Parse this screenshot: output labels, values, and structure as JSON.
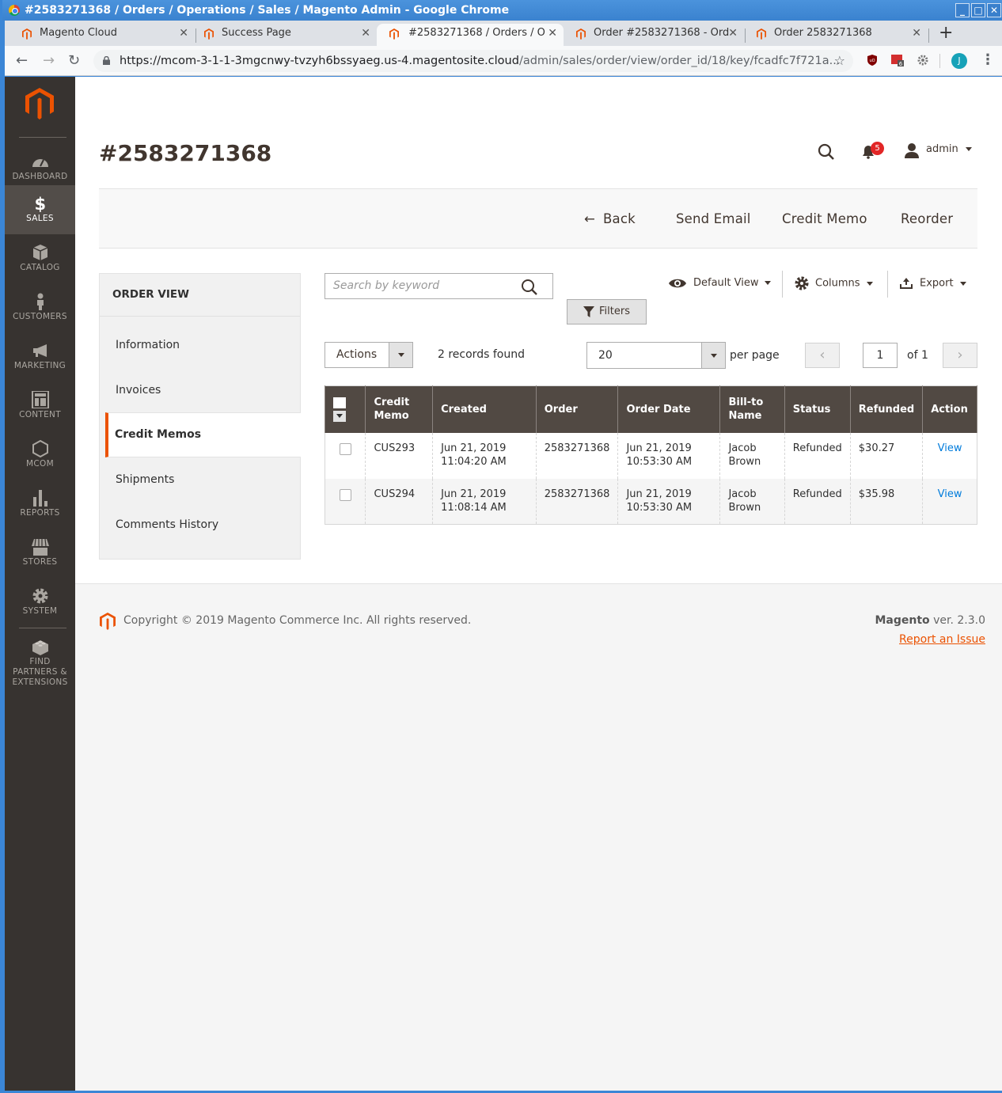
{
  "browser": {
    "window_title": "#2583271368 / Orders / Operations / Sales / Magento Admin - Google Chrome",
    "tabs": [
      {
        "title": "Magento Cloud",
        "active": false
      },
      {
        "title": "Success Page",
        "active": false
      },
      {
        "title": "#2583271368 / Orders / O",
        "active": true
      },
      {
        "title": "Order #2583271368 - Ord",
        "active": false
      },
      {
        "title": "Order 2583271368",
        "active": false
      }
    ],
    "url_host": "https://mcom-3-1-1-3mgcnwy-tvzyh6bssyaeg.us-4.magentosite.cloud",
    "url_path": "/admin/sales/order/view/order_id/18/key/fcadfc7f721a...",
    "extension_badge": "6",
    "profile_initial": "J"
  },
  "sidebar": {
    "items": [
      {
        "label": "DASHBOARD",
        "icon": "dashboard-icon",
        "active": false
      },
      {
        "label": "SALES",
        "icon": "dollar-icon",
        "active": true
      },
      {
        "label": "CATALOG",
        "icon": "box-icon",
        "active": false
      },
      {
        "label": "CUSTOMERS",
        "icon": "person-icon",
        "active": false
      },
      {
        "label": "MARKETING",
        "icon": "megaphone-icon",
        "active": false
      },
      {
        "label": "CONTENT",
        "icon": "layout-icon",
        "active": false
      },
      {
        "label": "MCOM",
        "icon": "hexagon-icon",
        "active": false
      },
      {
        "label": "REPORTS",
        "icon": "bar-chart-icon",
        "active": false
      },
      {
        "label": "STORES",
        "icon": "storefront-icon",
        "active": false
      },
      {
        "label": "SYSTEM",
        "icon": "gear-icon",
        "active": false
      },
      {
        "label": "FIND PARTNERS & EXTENSIONS",
        "icon": "lego-brick-icon",
        "active": false
      }
    ]
  },
  "header": {
    "title": "#2583271368",
    "notification_count": "5",
    "user": "admin"
  },
  "page_actions": {
    "back": "Back",
    "send_email": "Send Email",
    "credit_memo": "Credit Memo",
    "reorder": "Reorder"
  },
  "order_view": {
    "title": "ORDER VIEW",
    "items": [
      {
        "label": "Information",
        "active": false
      },
      {
        "label": "Invoices",
        "active": false
      },
      {
        "label": "Credit Memos",
        "active": true
      },
      {
        "label": "Shipments",
        "active": false
      },
      {
        "label": "Comments History",
        "active": false
      }
    ]
  },
  "grid": {
    "search_placeholder": "Search by keyword",
    "default_view": "Default View",
    "columns": "Columns",
    "export": "Export",
    "filters": "Filters",
    "actions": "Actions",
    "records_found": "2 records found",
    "per_page_value": "20",
    "per_page_label": "per page",
    "current_page": "1",
    "total_pages": "of 1",
    "headers": [
      "Credit Memo",
      "Created",
      "Order",
      "Order Date",
      "Bill-to Name",
      "Status",
      "Refunded",
      "Action"
    ],
    "rows": [
      {
        "credit_memo": "CUS293",
        "created": "Jun 21, 2019 11:04:20 AM",
        "order": "2583271368",
        "order_date": "Jun 21, 2019 10:53:30 AM",
        "bill_to": "Jacob Brown",
        "status": "Refunded",
        "refunded": "$30.27",
        "action": "View"
      },
      {
        "credit_memo": "CUS294",
        "created": "Jun 21, 2019 11:08:14 AM",
        "order": "2583271368",
        "order_date": "Jun 21, 2019 10:53:30 AM",
        "bill_to": "Jacob Brown",
        "status": "Refunded",
        "refunded": "$35.98",
        "action": "View"
      }
    ]
  },
  "footer": {
    "copyright": "Copyright © 2019 Magento Commerce Inc. All rights reserved.",
    "brand": "Magento",
    "version": "ver. 2.3.0",
    "report_issue": "Report an Issue"
  },
  "colors": {
    "accent": "#eb5202",
    "sidebar_bg": "#373330",
    "grid_header_bg": "#514943",
    "link": "#007bdb",
    "badge": "#e22626"
  }
}
